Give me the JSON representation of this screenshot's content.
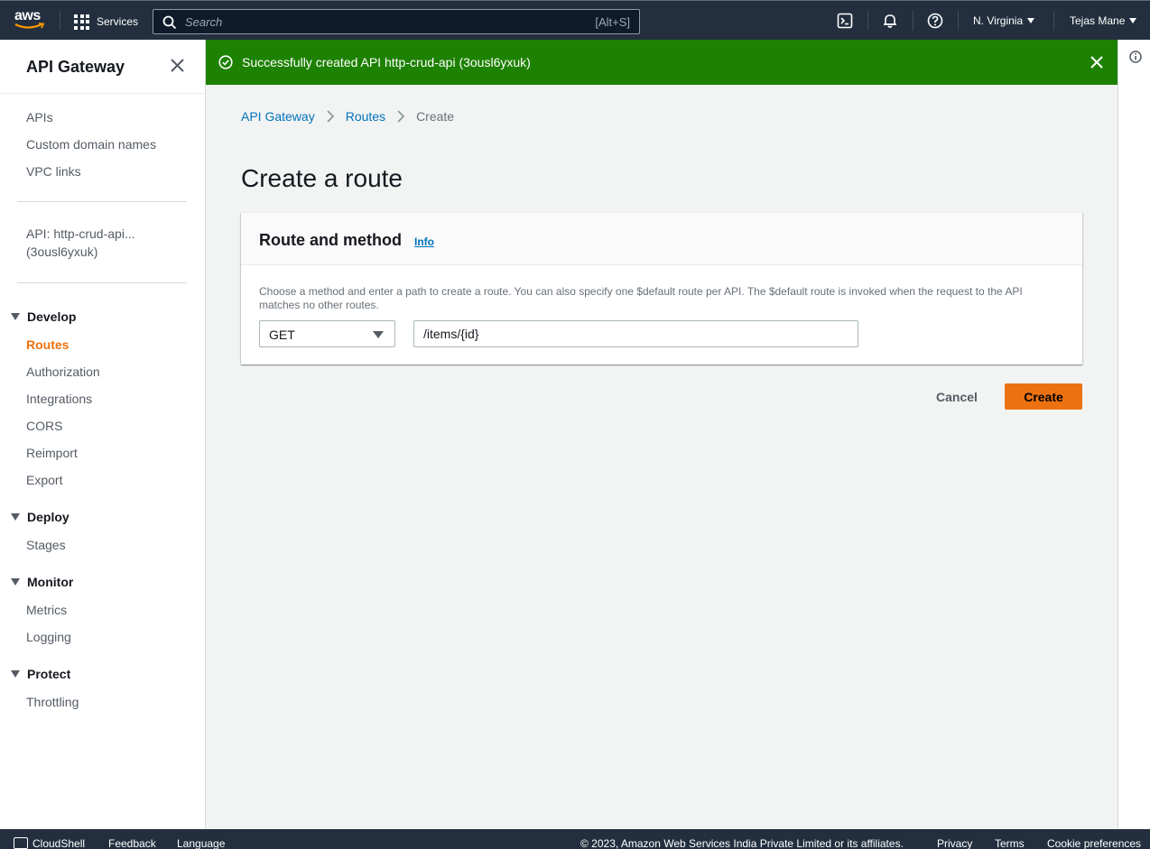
{
  "topnav": {
    "logo": "aws",
    "services_label": "Services",
    "search_placeholder": "Search",
    "search_shortcut": "[Alt+S]",
    "region": "N. Virginia",
    "user": "Tejas Mane",
    "icons": [
      "cloudshell-icon",
      "bell-icon",
      "help-icon"
    ]
  },
  "flash": {
    "message": "Successfully created API http-crud-api (3ousl6yxuk)",
    "type": "success",
    "color": "#1d8102"
  },
  "sidebar": {
    "title": "API Gateway",
    "top_links": [
      "APIs",
      "Custom domain names",
      "VPC links"
    ],
    "api_line1": "API: http-crud-api...",
    "api_line2": "(3ousl6yxuk)",
    "sections": [
      {
        "title": "Develop",
        "items": [
          "Routes",
          "Authorization",
          "Integrations",
          "CORS",
          "Reimport",
          "Export"
        ]
      },
      {
        "title": "Deploy",
        "items": [
          "Stages"
        ]
      },
      {
        "title": "Monitor",
        "items": [
          "Metrics",
          "Logging"
        ]
      },
      {
        "title": "Protect",
        "items": [
          "Throttling"
        ]
      }
    ],
    "active_item": "Routes",
    "active_color": "#ec7211"
  },
  "breadcrumb": [
    "API Gateway",
    "Routes",
    "Create"
  ],
  "page_title": "Create a route",
  "panel": {
    "title": "Route and method",
    "info_link": "Info",
    "description": "Choose a method and enter a path to create a route. You can also specify one $default route per API. The $default route is invoked when the request to the API matches no other routes.",
    "method_value": "GET",
    "path_value": "/items/{id}"
  },
  "actions": {
    "cancel": "Cancel",
    "create": "Create",
    "primary_color": "#ec7211"
  },
  "footer": {
    "cloudshell": "CloudShell",
    "feedback": "Feedback",
    "language": "Language",
    "copyright": "© 2023, Amazon Web Services India Private Limited or its affiliates.",
    "privacy": "Privacy",
    "terms": "Terms",
    "cookie": "Cookie preferences"
  }
}
